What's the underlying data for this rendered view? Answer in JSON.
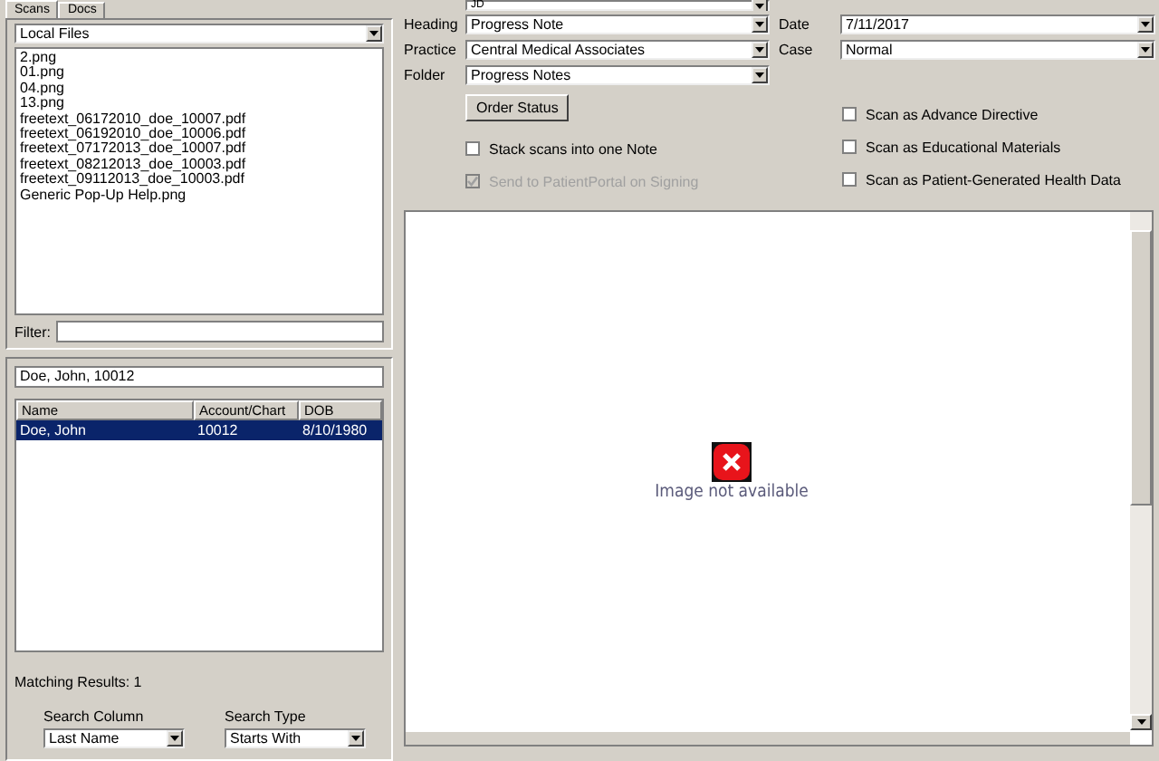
{
  "tabs": [
    {
      "label": "Scans",
      "selected": true
    },
    {
      "label": "Docs",
      "selected": false
    }
  ],
  "source": {
    "value": "Local Files"
  },
  "files": [
    {
      "name": "2.png"
    },
    {
      "name": "01.png"
    },
    {
      "name": "04.png"
    },
    {
      "name": "13.png"
    },
    {
      "name": "freetext_06172010_doe_10007.pdf"
    },
    {
      "name": "freetext_06192010_doe_10006.pdf"
    },
    {
      "name": "freetext_07172013_doe_10007.pdf"
    },
    {
      "name": "freetext_08212013_doe_10003.pdf"
    },
    {
      "name": "freetext_09112013_doe_10003.pdf"
    },
    {
      "name": "Generic Pop-Up Help.png"
    }
  ],
  "filter": {
    "label": "Filter:"
  },
  "patient_search": {
    "value": "Doe, John, 10012"
  },
  "results": {
    "columns": [
      "Name",
      "Account/Chart",
      "DOB"
    ],
    "rows": [
      {
        "cells": [
          "Doe, John",
          "10012",
          "8/10/1980"
        ],
        "selected": true
      }
    ]
  },
  "matching": "Matching Results: 1",
  "search_column": {
    "label": "Search Column",
    "value": "Last Name"
  },
  "search_type": {
    "label": "Search Type",
    "value": "Starts With"
  },
  "top_field": {
    "value": "JD"
  },
  "fields": [
    {
      "label": "Heading",
      "value": "Progress Note"
    },
    {
      "label": "Practice",
      "value": "Central Medical Associates"
    },
    {
      "label": "Folder",
      "value": "Progress Notes"
    }
  ],
  "date": {
    "label": "Date",
    "value": "7/11/2017"
  },
  "case": {
    "label": "Case",
    "value": "Normal"
  },
  "order_button": "Order Status",
  "left_checks": [
    {
      "label": "Stack scans into one Note",
      "checked": false,
      "disabled": false
    },
    {
      "label": "Send to PatientPortal on Signing",
      "checked": true,
      "disabled": true
    }
  ],
  "right_checks": [
    {
      "label": "Scan as Advance Directive",
      "checked": false
    },
    {
      "label": "Scan as Educational Materials",
      "checked": false
    },
    {
      "label": "Scan as Patient-Generated Health Data",
      "checked": false
    }
  ],
  "preview": {
    "message": "Image not available"
  }
}
